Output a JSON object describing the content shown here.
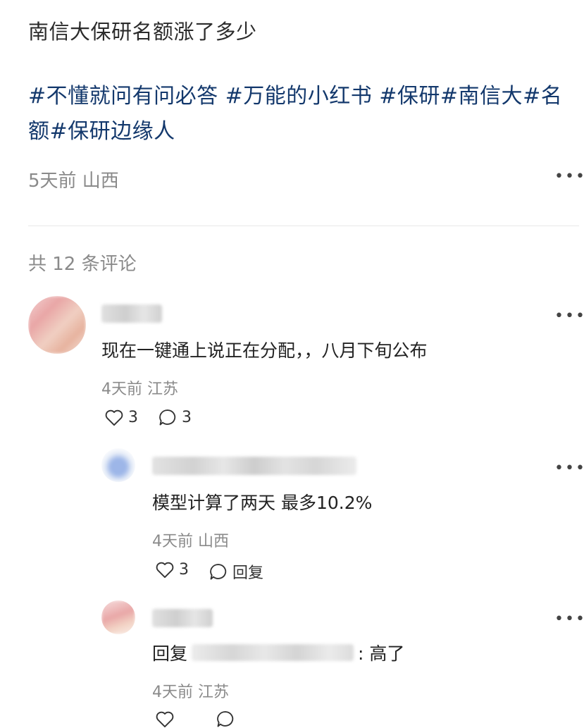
{
  "post": {
    "title": "南信大保研名额涨了多少",
    "tags": [
      "#不懂就问有问必答",
      "#万能的小红书",
      "#保研",
      "#南信大",
      "#名额",
      "#保研边缘人"
    ],
    "meta": "5天前 山西"
  },
  "comments_header": "共 12 条评论",
  "comments": [
    {
      "text": "现在一键通上说正在分配，，八月下旬公布",
      "meta": "4天前 江苏",
      "likes": "3",
      "replies": "3"
    }
  ],
  "replies": [
    {
      "text": "模型计算了两天 最多10.2%",
      "meta": "4天前 山西",
      "likes": "3",
      "reply_label": "回复"
    },
    {
      "text_prefix": "回复",
      "text_suffix": ": 高了",
      "meta": "4天前 江苏"
    }
  ],
  "colors": {
    "tag": "#13386c",
    "meta": "#8a8a8a",
    "text": "#222222"
  }
}
